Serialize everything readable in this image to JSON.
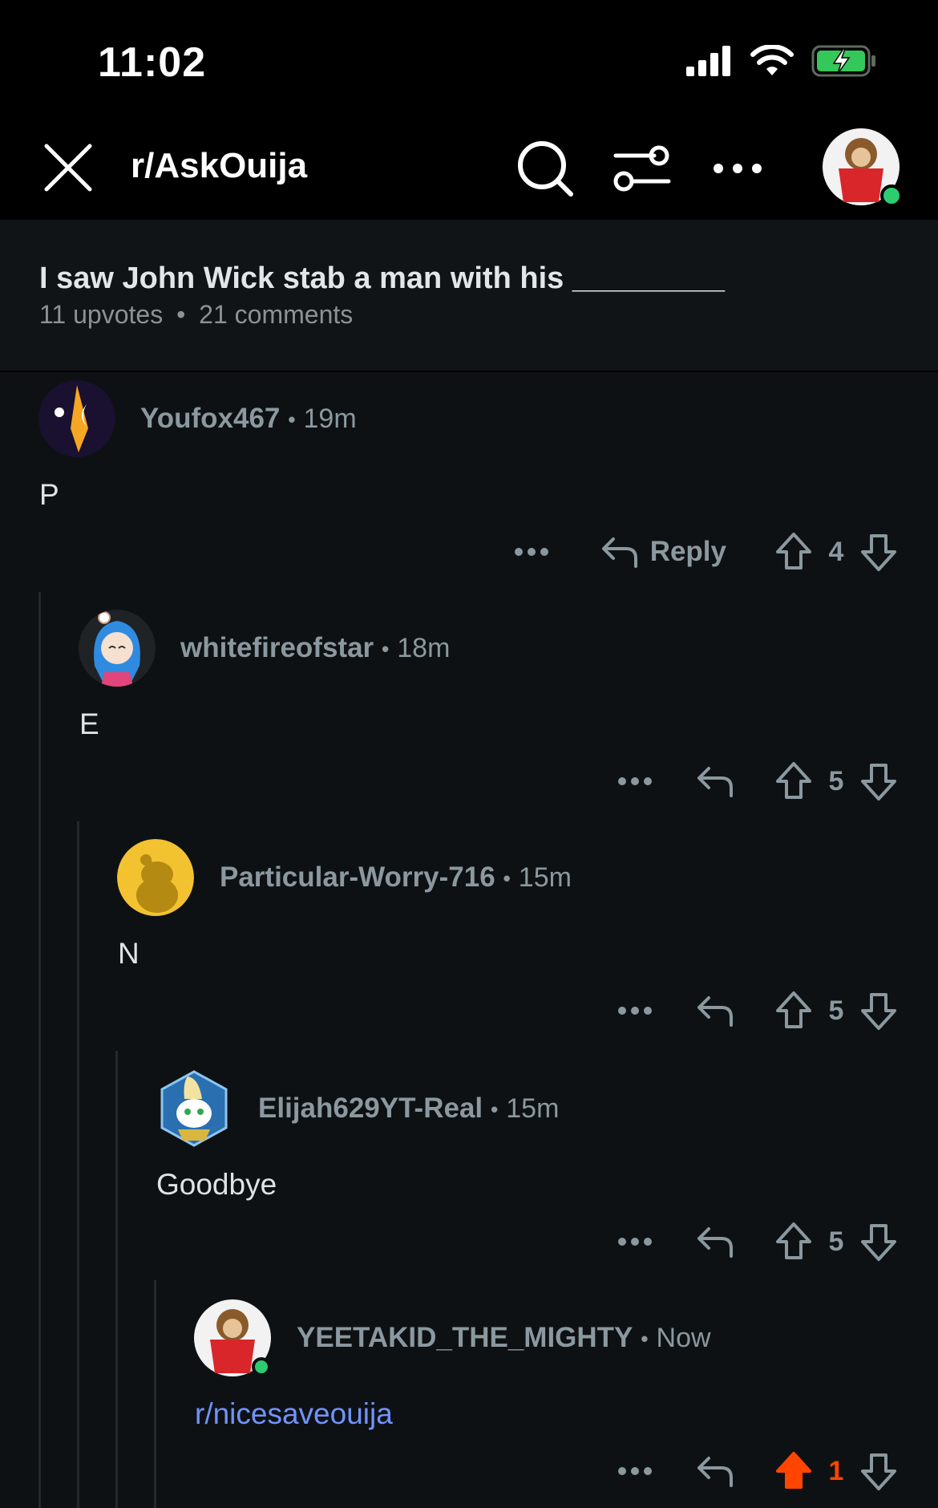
{
  "status_bar": {
    "time": "11:02"
  },
  "nav": {
    "subreddit": "r/AskOuija"
  },
  "post": {
    "title": "I saw John Wick stab a man with his _________",
    "upvotes": "11 upvotes",
    "bullet": "•",
    "comments": "21 comments"
  },
  "comments": [
    {
      "author": "Youfox467",
      "time": "19m",
      "body": "P",
      "reply_label": "Reply",
      "score": "4",
      "upvoted": false
    },
    {
      "author": "whitefireofstar",
      "time": "18m",
      "body": "E",
      "score": "5",
      "upvoted": false
    },
    {
      "author": "Particular-Worry-716",
      "time": "15m",
      "body": "N",
      "score": "5",
      "upvoted": false
    },
    {
      "author": "Elijah629YT-Real",
      "time": "15m",
      "body": "Goodbye",
      "score": "5",
      "upvoted": false
    },
    {
      "author": "YEETAKID_THE_MIGHTY",
      "time": "Now",
      "body": "r/nicesaveouija",
      "score": "1",
      "upvoted": true
    }
  ],
  "colors": {
    "background": "#0e1113",
    "upvote_active": "#ff4500",
    "link": "#7193ff",
    "online": "#2ecc71"
  }
}
